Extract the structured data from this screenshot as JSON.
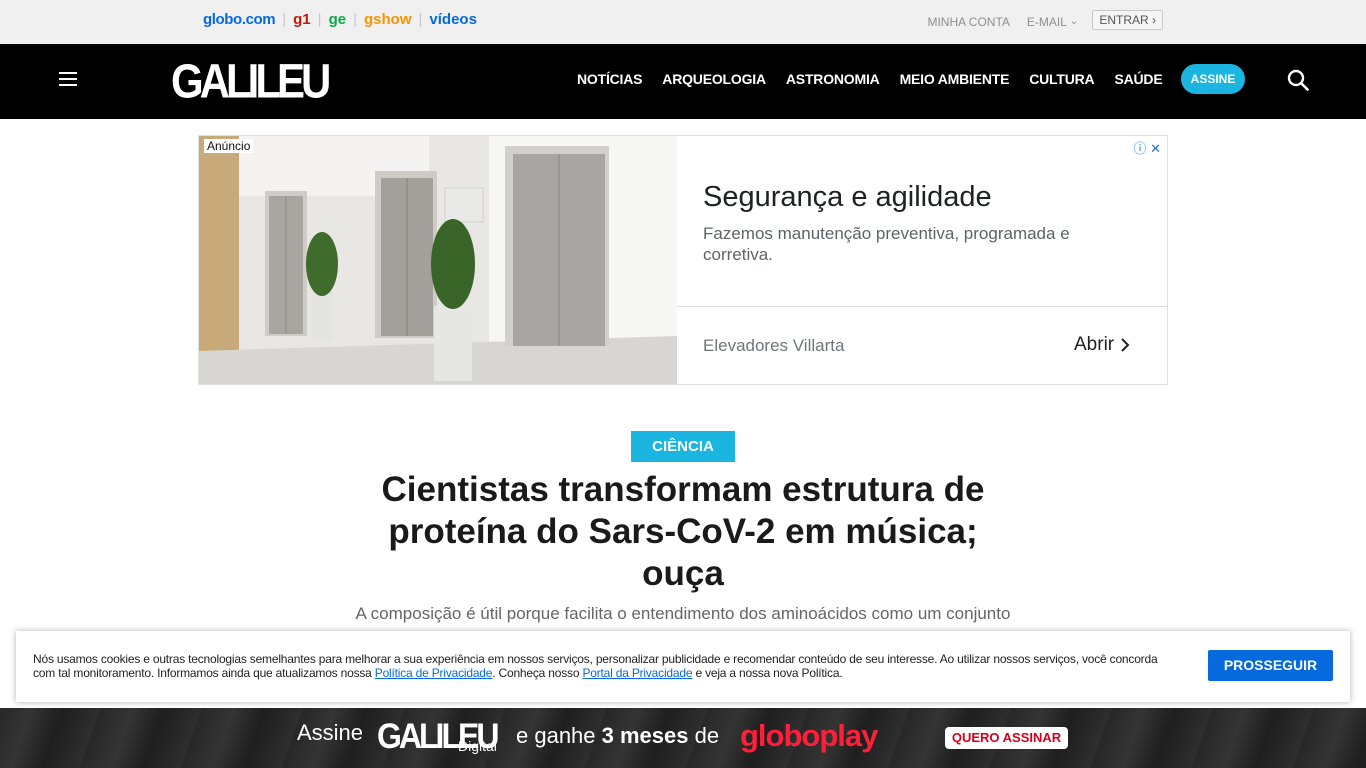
{
  "globobar": {
    "links": [
      "globo.com",
      "g1",
      "ge",
      "gshow",
      "vídeos"
    ],
    "account": "MINHA CONTA",
    "email": "E-MAIL",
    "enter": "ENTRAR"
  },
  "header": {
    "logo": "GALILEU",
    "nav": [
      "NOTÍCIAS",
      "ARQUEOLOGIA",
      "ASTRONOMIA",
      "MEIO AMBIENTE",
      "CULTURA",
      "SAÚDE"
    ],
    "subscribe": "ASSINE",
    "icons": [
      "menu-icon",
      "search-icon"
    ]
  },
  "ad": {
    "label": "Anúncio",
    "title": "Segurança e agilidade",
    "description": "Fazemos manutenção preventiva, programada e corretiva.",
    "advertiser": "Elevadores Villarta",
    "cta": "Abrir"
  },
  "article": {
    "category": "CIÊNCIA",
    "title": "Cientistas transformam estrutura de proteína do Sars-CoV-2 em música; ouça",
    "subtitle": "A composição é útil porque facilita o entendimento dos aminoácidos como um conjunto"
  },
  "cookie": {
    "text_1": "Nós usamos cookies e outras tecnologias semelhantes para melhorar a sua experiência em nossos serviços, personalizar publicidade e recomendar conteúdo de seu interesse. Ao utilizar nossos serviços, você concorda com tal monitoramento. Informamos ainda que atualizamos nossa ",
    "link_1": "Política de Privacidade",
    "text_2": ". Conheça nosso ",
    "link_2": "Portal da Privacidade",
    "text_3": " e veja a nossa nova Política.",
    "button": "PROSSEGUIR"
  },
  "promo": {
    "assine": "Assine",
    "logo": "GALILEU",
    "digital": "Digital",
    "text_prefix": "e ganhe ",
    "text_bold": "3 meses",
    "text_suffix": " de",
    "brand": "globoplay",
    "button": "QUERO ASSINAR"
  }
}
